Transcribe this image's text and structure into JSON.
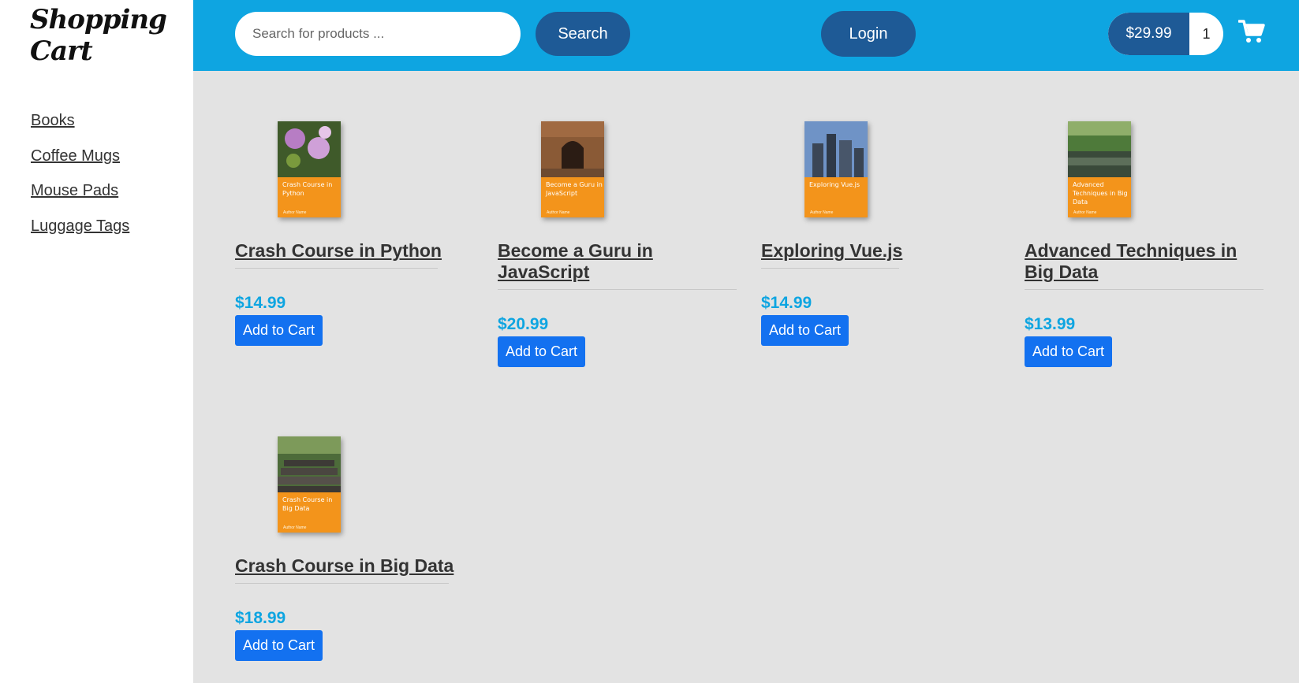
{
  "logo": "Shopping Cart",
  "categories": [
    "Books",
    "Coffee Mugs",
    "Mouse Pads",
    "Luggage Tags"
  ],
  "header": {
    "search_placeholder": "Search for products ...",
    "search_label": "Search",
    "login_label": "Login",
    "cart_total": "$29.99",
    "cart_count": "1",
    "cart_icon": "shopping-cart-icon"
  },
  "colors": {
    "header": "#0ea5e1",
    "pill": "#1e5a96",
    "price": "#0ea5e1",
    "button": "#1371f0",
    "cover_band": "#f3941b"
  },
  "products": [
    {
      "title": "Crash Course in Python",
      "price": "$14.99",
      "button": "Add to Cart",
      "cover_title": "Crash Course in Python",
      "cover_author": "Author Name"
    },
    {
      "title": "Become a Guru in JavaScript",
      "price": "$20.99",
      "button": "Add to Cart",
      "cover_title": "Become a Guru in JavaScript",
      "cover_author": "Author Name"
    },
    {
      "title": "Exploring Vue.js",
      "price": "$14.99",
      "button": "Add to Cart",
      "cover_title": "Exploring Vue.js",
      "cover_author": "Author Name"
    },
    {
      "title": "Advanced Techniques in Big Data",
      "price": "$13.99",
      "button": "Add to Cart",
      "cover_title": "Advanced Techniques in Big Data",
      "cover_author": "Author Name"
    },
    {
      "title": "Crash Course in Big Data",
      "price": "$18.99",
      "button": "Add to Cart",
      "cover_title": "Crash Course in Big Data",
      "cover_author": "Author Name"
    }
  ]
}
